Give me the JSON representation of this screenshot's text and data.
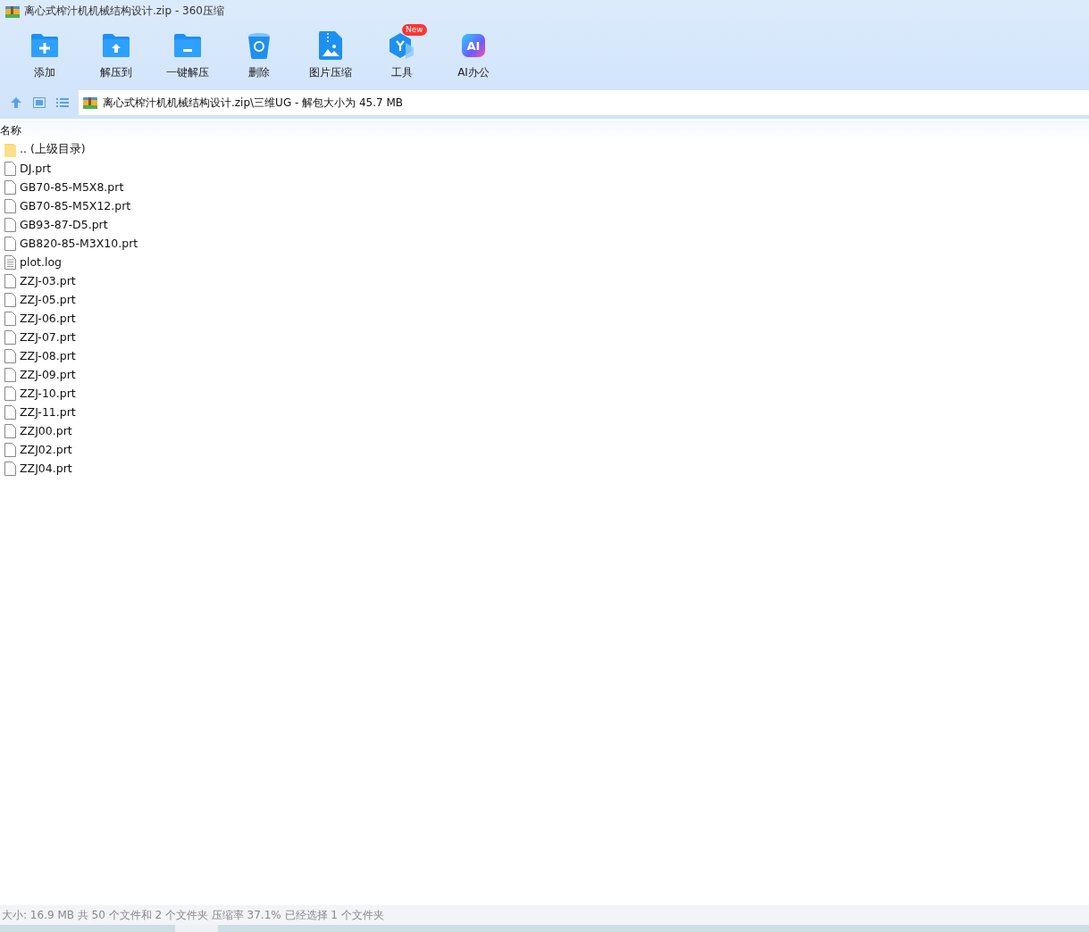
{
  "window": {
    "title": "离心式榨汁机机械结构设计.zip - 360压缩"
  },
  "toolbar": [
    {
      "kind": "add",
      "label": "添加"
    },
    {
      "kind": "extract",
      "label": "解压到"
    },
    {
      "kind": "onekey",
      "label": "一键解压"
    },
    {
      "kind": "delete",
      "label": "删除"
    },
    {
      "kind": "image",
      "label": "图片压缩"
    },
    {
      "kind": "tools",
      "label": "工具",
      "badge": "New"
    },
    {
      "kind": "ai",
      "label": "AI办公",
      "icon_text": "AI"
    }
  ],
  "address": {
    "path": "离心式榨汁机机械结构设计.zip\\三维UG - 解包大小为 45.7 MB"
  },
  "table": {
    "columns": [
      "名称"
    ],
    "rows": [
      {
        "kind": "folder",
        "name": ".. (上级目录)"
      },
      {
        "kind": "file",
        "name": "DJ.prt"
      },
      {
        "kind": "file",
        "name": "GB70-85-M5X8.prt"
      },
      {
        "kind": "file",
        "name": "GB70-85-M5X12.prt"
      },
      {
        "kind": "file",
        "name": "GB93-87-D5.prt"
      },
      {
        "kind": "file",
        "name": "GB820-85-M3X10.prt"
      },
      {
        "kind": "text",
        "name": "plot.log"
      },
      {
        "kind": "file",
        "name": "ZZJ-03.prt"
      },
      {
        "kind": "file",
        "name": "ZZJ-05.prt"
      },
      {
        "kind": "file",
        "name": "ZZJ-06.prt"
      },
      {
        "kind": "file",
        "name": "ZZJ-07.prt"
      },
      {
        "kind": "file",
        "name": "ZZJ-08.prt"
      },
      {
        "kind": "file",
        "name": "ZZJ-09.prt"
      },
      {
        "kind": "file",
        "name": "ZZJ-10.prt"
      },
      {
        "kind": "file",
        "name": "ZZJ-11.prt"
      },
      {
        "kind": "file",
        "name": "ZZJ00.prt"
      },
      {
        "kind": "file",
        "name": "ZZJ02.prt"
      },
      {
        "kind": "file",
        "name": "ZZJ04.prt"
      }
    ]
  },
  "status_bar": "大小: 16.9 MB 共 50 个文件和 2 个文件夹 压缩率 37.1% 已经选择 1 个文件夹"
}
